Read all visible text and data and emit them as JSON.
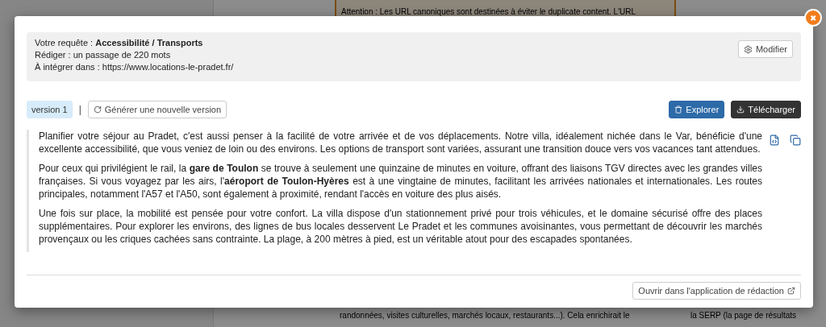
{
  "background": {
    "notice": "Attention : Les URL canoniques sont destinées à éviter le duplicate content. L'URL",
    "body_line": "randonnées, visites culturelles, marchés locaux, restaurants...). Cela enrichirait le",
    "side_line": "la SERP (la page de résultats"
  },
  "modal": {
    "close": "✖",
    "request": {
      "lines": [
        "Votre requête : **Accessibilité / Transports**",
        "Rédiger : un passage de 220 mots",
        "À intégrer dans : https://www.locations-le-pradet.fr/"
      ],
      "edit_button": "Modifier"
    },
    "versions": [
      {
        "label": "version 1",
        "selected": true
      }
    ],
    "separator": "|",
    "generate_button": "Générer une nouvelle version",
    "explore_button": "Explorer",
    "download_button": "Télécharger",
    "paragraphs": [
      "Planifier votre séjour au Pradet, c'est aussi penser à la facilité de votre arrivée et de vos déplacements. Notre villa, idéalement nichée dans le Var, bénéficie d'une excellente accessibilité, que vous veniez de loin ou des environs. Les options de transport sont variées, assurant une transition douce vers vos vacances tant attendues.",
      "Pour ceux qui privilégient le rail, la **gare de Toulon** se trouve à seulement une quinzaine de minutes en voiture, offrant des liaisons TGV directes avec les grandes villes françaises. Si vous voyagez par les airs, l'**aéroport de Toulon-Hyères** est à une vingtaine de minutes, facilitant les arrivées nationales et internationales. Les routes principales, notamment l'A57 et l'A50, sont également à proximité, rendant l'accès en voiture des plus aisés.",
      "Une fois sur place, la mobilité est pensée pour votre confort. La villa dispose d'un stationnement privé pour trois véhicules, et le domaine sécurisé offre des places supplémentaires. Pour explorer les environs, des lignes de bus locales desservent Le Pradet et les communes avoisinantes, vous permettant de découvrir les marchés provençaux ou les criques cachées sans contrainte. La plage, à 200 mètres à pied, est un véritable atout pour des escapades spontanées."
    ],
    "open_editor_button": "Ouvrir dans l'application de rédaction"
  }
}
